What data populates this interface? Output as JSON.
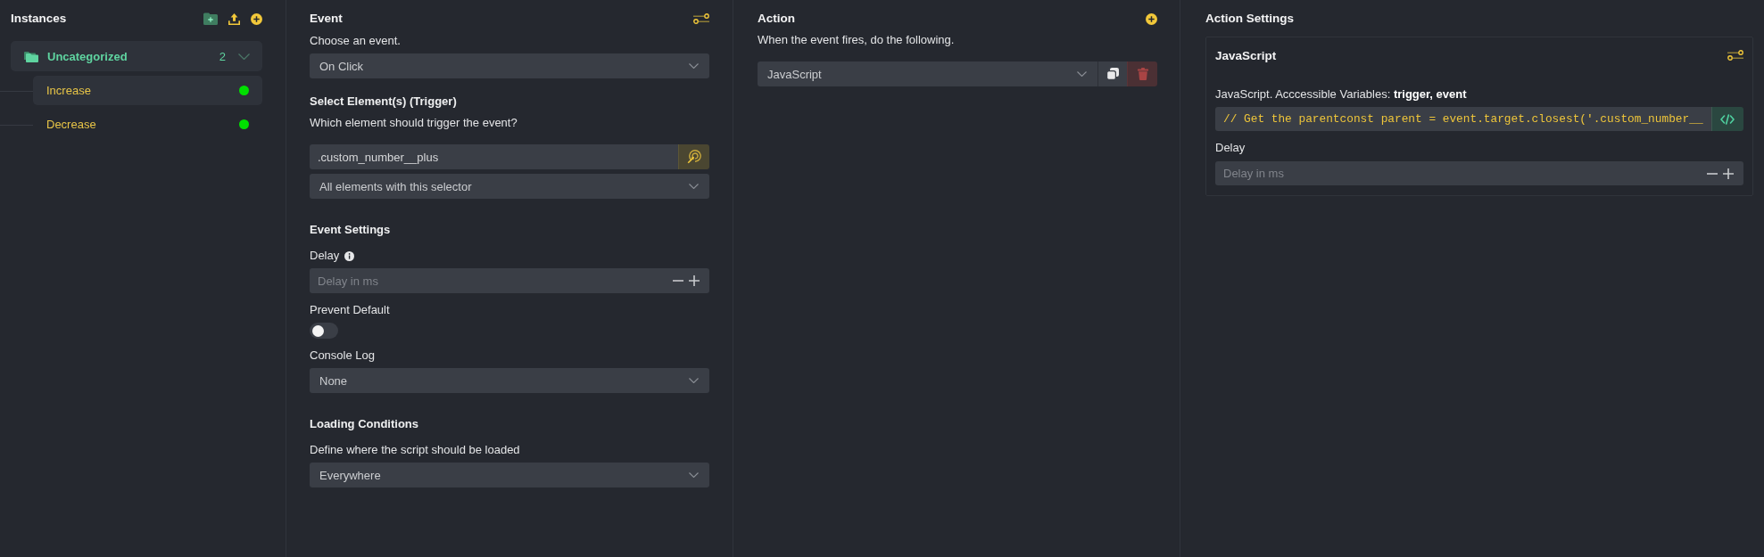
{
  "sidebar": {
    "title": "Instances",
    "groups": [
      {
        "name": "Uncategorized",
        "count": "2",
        "expanded": true,
        "children": [
          {
            "label": "Increase",
            "selected": true,
            "color": "#00e000"
          },
          {
            "label": "Decrease",
            "selected": false,
            "color": "#00e000"
          }
        ]
      }
    ]
  },
  "event_panel": {
    "title": "Event",
    "items": [
      {
        "kind": "label",
        "text": "Choose an event."
      },
      {
        "kind": "select",
        "value": "On Click"
      },
      {
        "kind": "heading",
        "text": "Select Element(s) (Trigger)"
      },
      {
        "kind": "label",
        "text": "Which element should trigger the event?"
      },
      {
        "kind": "picker",
        "value": ".custom_number__plus"
      },
      {
        "kind": "select",
        "value": "All elements with this selector"
      },
      {
        "kind": "heading",
        "text": "Event Settings"
      },
      {
        "kind": "label",
        "text": "Delay",
        "info": true
      },
      {
        "kind": "number",
        "placeholder": "Delay in ms"
      },
      {
        "kind": "label",
        "text": "Prevent Default"
      },
      {
        "kind": "toggle",
        "on": false
      },
      {
        "kind": "label",
        "text": "Console Log"
      },
      {
        "kind": "select",
        "value": "None"
      },
      {
        "kind": "heading",
        "text": "Loading Conditions"
      },
      {
        "kind": "label",
        "text": "Define where the script should be loaded"
      },
      {
        "kind": "select",
        "value": "Everywhere"
      }
    ]
  },
  "action_panel": {
    "title": "Action",
    "description": "When the event fires, do the following.",
    "actions": [
      {
        "value": "JavaScript"
      }
    ]
  },
  "action_settings": {
    "title": "Action Settings",
    "cards": [
      {
        "title": "JavaScript",
        "code_label": "JavaScript. Acccessible Variables: **trigger, event**",
        "code": "// Get the parentconst parent = event.target.closest('.custom_number__",
        "delay_label": "Delay",
        "delay_placeholder": "Delay in ms"
      }
    ]
  }
}
